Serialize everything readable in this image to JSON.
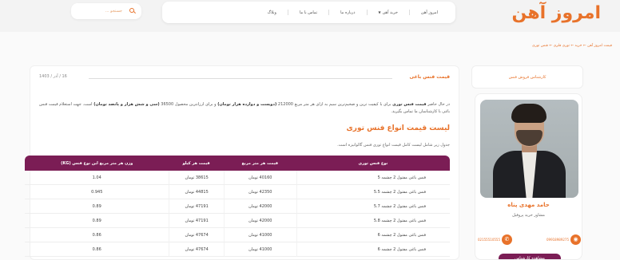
{
  "header": {
    "logo_text": "امروز آهن",
    "nav": [
      {
        "label": "امروز آهن"
      },
      {
        "label": "خرید آهن",
        "dropdown": true
      },
      {
        "label": "درباره ما"
      },
      {
        "label": "تماس با ما"
      },
      {
        "label": "وبلاگ"
      }
    ],
    "search_placeholder": "جستجو ..."
  },
  "breadcrumb": "قیمت امروز آهن ← خرید ← توری فلزی ← فنس توری",
  "sidebar": {
    "tab_label": "کارشناس فروش فنس",
    "expert": {
      "name": "حامد مهدی پناه",
      "role": "مشاور خرید پروفیل",
      "phone_landline": "02155510555",
      "phone_mobile": "09918989275",
      "profile_button": "مشاهده کارشناس"
    }
  },
  "main": {
    "section_title": "قیمت فنس باغی",
    "date": "16 / آذر / 1403",
    "paragraph_parts": [
      "در حال حاضر ",
      "قیمت فنس توری",
      " برای با کیفیت ترین و ضخیم‌ترین سیم به ازای هر متر مربع 212000 ",
      "(دویست و دوازده هزار تومان)",
      " و برای ارزانترین محصول 36500 ",
      "(سی و شش هزار و پانصد تومان)",
      " است. جهت استعلام قیمت فنس باغی با کارشناسان ما تماس بگیرید."
    ],
    "heading": "لیست قیمت انواع فنس توری",
    "table_intro": "جدول زیر شامل لیست کامل قیمت انواع توری فنس گالوانیزه است.",
    "table": {
      "columns": [
        "نوع فنس توری",
        "قیمت هر متر مربع",
        "قیمت هر کیلو",
        "وزن هر متر مربع این نوع فنس (KG)"
      ],
      "rows": [
        [
          "فنس باغی مفتول 2 چشمه 5",
          "40160 تومان",
          "38615 تومان",
          "1.04"
        ],
        [
          "فنس باغی مفتول 2 چشمه 5.5",
          "42350 تومان",
          "44815 تومان",
          "0.945"
        ],
        [
          "فنس باغی مفتول 2 چشمه 5.7",
          "42000 تومان",
          "47191 تومان",
          "0.89"
        ],
        [
          "فنس باغی مفتول 2 چشمه 5.8",
          "42000 تومان",
          "47191 تومان",
          "0.89"
        ],
        [
          "فنس باغی مفتول 2 چشمه 6",
          "41000 تومان",
          "47674 تومان",
          "0.86"
        ],
        [
          "فنس باغی مفتول 2 چشمه 6",
          "41000 تومان",
          "47674 تومان",
          "0.86"
        ]
      ]
    }
  },
  "colors": {
    "accent": "#e8722a",
    "table_header": "#7b1d55"
  }
}
